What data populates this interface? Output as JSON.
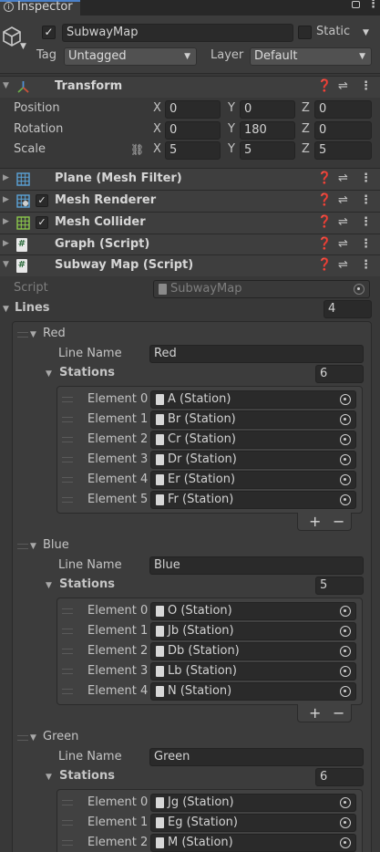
{
  "tab": {
    "title": "Inspector"
  },
  "object": {
    "name": "SubwayMap",
    "static_label": "Static",
    "tag_label": "Tag",
    "tag_value": "Untagged",
    "layer_label": "Layer",
    "layer_value": "Default"
  },
  "transform": {
    "title": "Transform",
    "position_label": "Position",
    "rotation_label": "Rotation",
    "scale_label": "Scale",
    "x": "X",
    "y": "Y",
    "z": "Z",
    "position": [
      "0",
      "0",
      "0"
    ],
    "rotation": [
      "0",
      "180",
      "0"
    ],
    "scale": [
      "5",
      "5",
      "5"
    ]
  },
  "components": {
    "plane": "Plane (Mesh Filter)",
    "mesh_renderer": "Mesh Renderer",
    "mesh_collider": "Mesh Collider",
    "graph": "Graph (Script)",
    "subway": "Subway Map (Script)"
  },
  "subway": {
    "script_label": "Script",
    "script_value": "SubwayMap",
    "lines_label": "Lines",
    "lines_count": "4",
    "line_name_label": "Line Name",
    "stations_label": "Stations",
    "lines": [
      {
        "header": "Red",
        "name": "Red",
        "count": "6",
        "elements": [
          {
            "label": "Element 0",
            "value": "A (Station)"
          },
          {
            "label": "Element 1",
            "value": "Br (Station)"
          },
          {
            "label": "Element 2",
            "value": "Cr (Station)"
          },
          {
            "label": "Element 3",
            "value": "Dr (Station)"
          },
          {
            "label": "Element 4",
            "value": "Er (Station)"
          },
          {
            "label": "Element 5",
            "value": "Fr (Station)"
          }
        ]
      },
      {
        "header": "Blue",
        "name": "Blue",
        "count": "5",
        "elements": [
          {
            "label": "Element 0",
            "value": "O (Station)"
          },
          {
            "label": "Element 1",
            "value": "Jb (Station)"
          },
          {
            "label": "Element 2",
            "value": "Db (Station)"
          },
          {
            "label": "Element 3",
            "value": "Lb (Station)"
          },
          {
            "label": "Element 4",
            "value": "N (Station)"
          }
        ]
      },
      {
        "header": "Green",
        "name": "Green",
        "count": "6",
        "elements": [
          {
            "label": "Element 0",
            "value": "Jg (Station)"
          },
          {
            "label": "Element 1",
            "value": "Eg (Station)"
          },
          {
            "label": "Element 2",
            "value": "M (Station)"
          }
        ]
      }
    ],
    "plus": "+",
    "minus": "−"
  }
}
